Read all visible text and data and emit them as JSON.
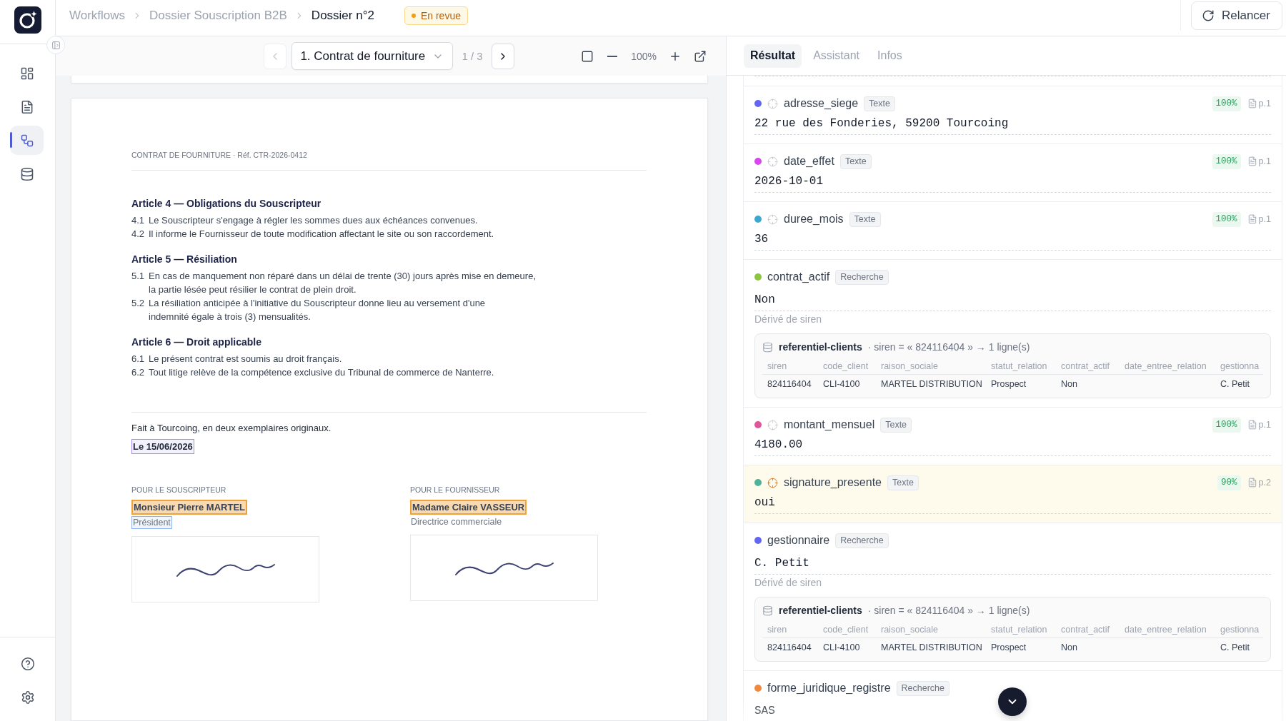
{
  "topbar": {
    "breadcrumb": [
      {
        "label": "Workflows",
        "current": false
      },
      {
        "label": "Dossier Souscription B2B",
        "current": false
      },
      {
        "label": "Dossier n°2",
        "current": true
      }
    ],
    "status": {
      "label": "En revue",
      "color": "#f59e0b"
    },
    "action": "Relancer"
  },
  "rail": {
    "items": [
      {
        "selected": false
      },
      {
        "selected": false
      },
      {
        "selected": true
      },
      {
        "selected": false
      }
    ]
  },
  "viewer": {
    "toolbar": {
      "prev": {
        "disabled": true
      },
      "document": "1. Contrat de fourniture",
      "pages": "1 / 3",
      "next": {
        "disabled": false
      },
      "zoom": "100%"
    },
    "page": {
      "header": "CONTRAT DE FOURNITURE · Réf. CTR-2026-0412",
      "articles": [
        {
          "title": "Article 4 — Obligations du Souscripteur",
          "clauses": [
            {
              "number": "4.1",
              "lines": [
                "Le Souscripteur s'engage à régler les sommes dues aux échéances convenues."
              ]
            },
            {
              "number": "4.2",
              "lines": [
                "Il informe le Fournisseur de toute modification affectant le site ou son raccordement."
              ]
            }
          ]
        },
        {
          "title": "Article 5 — Résiliation",
          "clauses": [
            {
              "number": "5.1",
              "lines": [
                "En cas de manquement non réparé dans un délai de trente (30) jours après mise en demeure,",
                "la partie lésée peut résilier le contrat de plein droit."
              ]
            },
            {
              "number": "5.2",
              "lines": [
                "La résiliation anticipée à l'initiative du Souscripteur donne lieu au versement d'une",
                "indemnité égale à trois (3) mensualités."
              ]
            }
          ]
        },
        {
          "title": "Article 6 — Droit applicable",
          "clauses": [
            {
              "number": "6.1",
              "lines": [
                "Le présent contrat est soumis au droit français."
              ]
            },
            {
              "number": "6.2",
              "lines": [
                "Tout litige relève de la compétence exclusive du Tribunal de commerce de Nanterre."
              ]
            }
          ]
        }
      ],
      "closing": "Fait à Tourcoing, en deux exemplaires originaux.",
      "date": {
        "text": "Le 15/06/2026",
        "kind": "outline",
        "color": "#a78bfa"
      },
      "signatories": [
        {
          "role": "POUR LE SOUSCRIPTEUR",
          "name": {
            "text": "Monsieur Pierre MARTEL",
            "kind": "fill",
            "color": "#f0a23a"
          },
          "title": {
            "text": "Président",
            "kind": "outline",
            "color": "#8fb3f0"
          }
        },
        {
          "role": "POUR LE FOURNISSEUR",
          "name": {
            "text": "Madame Claire VASSEUR",
            "kind": "fill",
            "color": "#f0a23a"
          },
          "title": {
            "text": "Directrice commerciale",
            "kind": "plain"
          }
        }
      ]
    }
  },
  "panel": {
    "tabs": [
      {
        "label": "Résultat",
        "selected": true
      },
      {
        "label": "Assistant",
        "selected": false
      },
      {
        "label": "Infos",
        "selected": false
      }
    ],
    "fields": [
      {
        "name": "adresse_siege",
        "kind": "extracted",
        "color": "#6366f1",
        "type": "Texte",
        "confidence": "100%",
        "page": "p.1",
        "value": "22 rue des Fonderies, 59200 Tourcoing",
        "selected": false
      },
      {
        "name": "date_effet",
        "kind": "extracted",
        "color": "#d946ef",
        "type": "Texte",
        "confidence": "100%",
        "page": "p.1",
        "value": "2026-10-01",
        "selected": false
      },
      {
        "name": "duree_mois",
        "kind": "extracted",
        "color": "#3aa9d0",
        "type": "Texte",
        "confidence": "100%",
        "page": "p.1",
        "value": "36",
        "selected": false
      },
      {
        "name": "contrat_actif",
        "kind": "lookup",
        "color": "#8cc63f",
        "type": "Recherche",
        "value": "Non",
        "selected": false,
        "derivation": "Dérivé de siren",
        "lookup": {
          "source": "referentiel-clients",
          "query": "· siren = « 824116404 » → 1 ligne(s)",
          "columns": [
            "siren",
            "code_client",
            "raison_sociale",
            "statut_relation",
            "contrat_actif",
            "date_entree_relation",
            "gestionna"
          ],
          "rows": [
            [
              "824116404",
              "CLI-4100",
              "MARTEL DISTRIBUTION",
              "Prospect",
              "Non",
              null,
              "C. Petit"
            ]
          ]
        }
      },
      {
        "name": "montant_mensuel",
        "kind": "extracted",
        "color": "#e0559b",
        "type": "Texte",
        "confidence": "100%",
        "page": "p.1",
        "value": "4180.00",
        "selected": false
      },
      {
        "name": "signature_presente",
        "kind": "extracted",
        "color": "#4fb39a",
        "type": "Texte",
        "confidence": "90%",
        "page": "p.2",
        "value": "oui",
        "selected": true
      },
      {
        "name": "gestionnaire",
        "kind": "lookup",
        "color": "#6366f1",
        "type": "Recherche",
        "value": "C. Petit",
        "selected": false,
        "derivation": "Dérivé de siren",
        "lookup": {
          "source": "referentiel-clients",
          "query": "· siren = « 824116404 » → 1 ligne(s)",
          "columns": [
            "siren",
            "code_client",
            "raison_sociale",
            "statut_relation",
            "contrat_actif",
            "date_entree_relation",
            "gestionna"
          ],
          "rows": [
            [
              "824116404",
              "CLI-4100",
              "MARTEL DISTRIBUTION",
              "Prospect",
              "Non",
              null,
              "C. Petit"
            ]
          ]
        }
      },
      {
        "name": "forme_juridique_registre",
        "kind": "lookup",
        "color": "#f0883e",
        "type": "Recherche",
        "value": "SAS",
        "selected": false
      }
    ]
  }
}
